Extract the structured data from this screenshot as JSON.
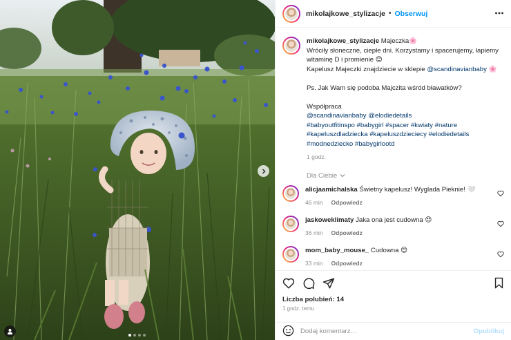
{
  "post_image": {
    "description_icon": "photo-child-in-cornflowers",
    "carousel_dots": 4,
    "active_dot": 0
  },
  "header": {
    "username": "mikolajkowe_stylizacje",
    "separator": "•",
    "follow_label": "Obserwuj",
    "more_icon": "more-horizontal-icon"
  },
  "caption": {
    "username": "mikolajkowe_stylizacje",
    "title": "Majeczka",
    "title_emoji": "🌸",
    "line1": "Wróciły słoneczne, ciepłe dni. Korzystamy i spacerujemy, łapiemy",
    "line2": "witaminę D i promienie",
    "line2_emoji": "😊",
    "line3_text": "Kapelusz Majeczki znajdziecie w sklepie",
    "line3_mention": "@scandinavianbaby",
    "line3_emoji": "🌸",
    "ps": "Ps. Jak Wam się podoba Majczita wśród bławatków?",
    "collab_label": "Współpraca",
    "mentions": [
      "@scandinavianbaby",
      "@elodiedetails"
    ],
    "hashtags_line1": [
      "#babyoutfitinspo",
      "#babygirl",
      "#spacer",
      "#kwiaty",
      "#nature"
    ],
    "hashtags_line2": [
      "#kapeluszdladziecka",
      "#kapeluszdzieciecy",
      "#elodiedetails"
    ],
    "hashtags_line3": [
      "#modnedziecko",
      "#babygirlootd"
    ],
    "time": "1 godz."
  },
  "for_you_label": "Dla Ciebie",
  "comments": [
    {
      "username": "alicjaamichalska",
      "text": "Świetny kapelusz! Wyglada Pieknie!",
      "emoji": "🤍",
      "time": "46 min",
      "reply": "Odpowiedz"
    },
    {
      "username": "jaskoweklimaty",
      "text": "Jaka ona jest cudowna",
      "emoji": "😍",
      "time": "36 min",
      "reply": "Odpowiedz"
    },
    {
      "username": "mom_baby_mouse_",
      "text": "Cudowna",
      "emoji": "😍",
      "time": "33 min",
      "reply": "Odpowiedz"
    }
  ],
  "likes": {
    "label": "Liczba polubień:",
    "count": "14"
  },
  "post_age": "1 godz. temu",
  "add_comment": {
    "placeholder": "Dodaj komentarz…",
    "post_label": "Opublikuj"
  },
  "colors": {
    "accent": "#0095f6",
    "link": "#00376b",
    "muted": "#8e8e8e",
    "post_disabled": "#b2dffc"
  }
}
